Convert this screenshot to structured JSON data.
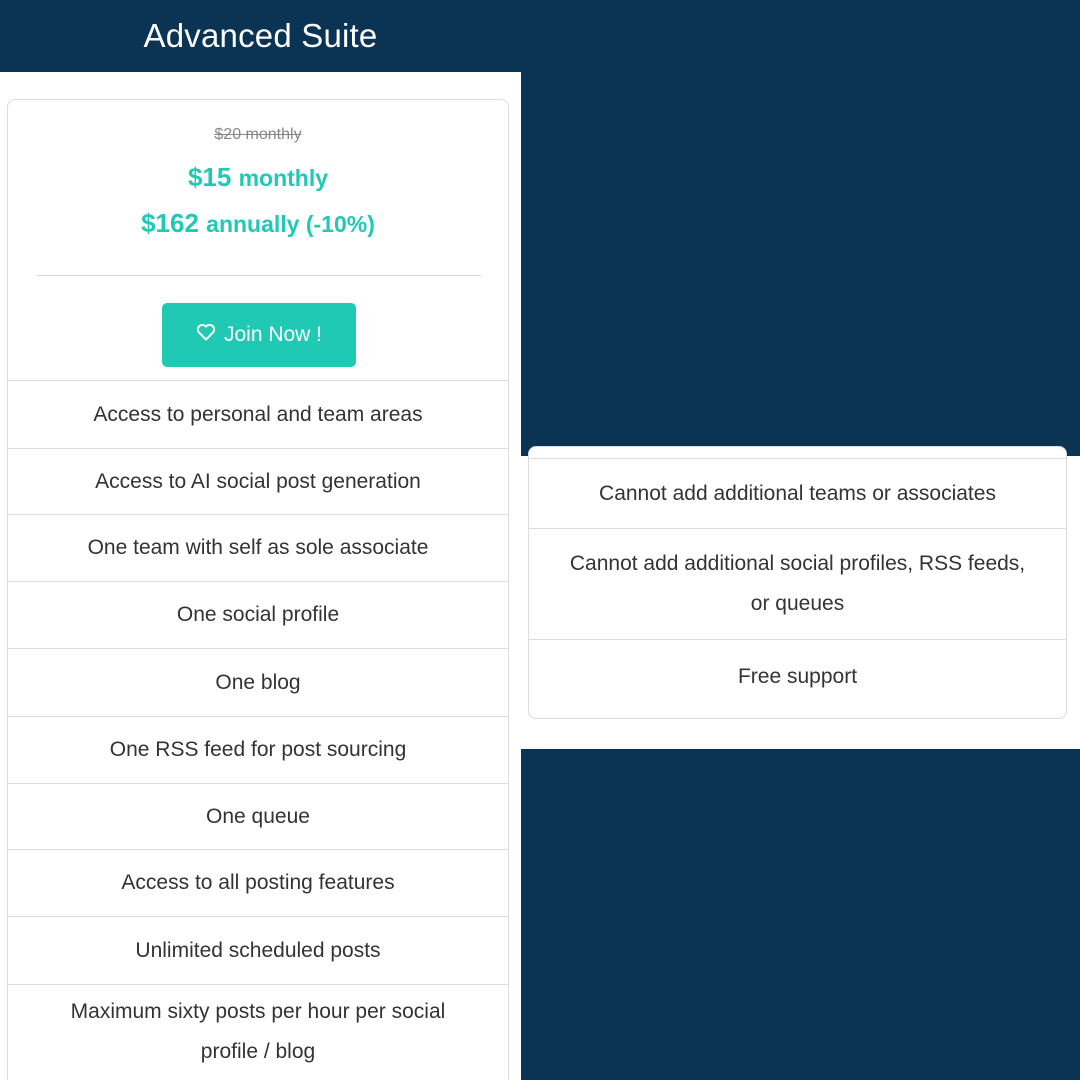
{
  "header": {
    "title": "Advanced Suite"
  },
  "pricing": {
    "old_price": "$20 monthly",
    "monthly_amount": "$15",
    "monthly_unit": "monthly",
    "annual_amount": "$162",
    "annual_unit": "annually (-10%)"
  },
  "cta": {
    "label": "Join Now !",
    "icon": "heart-icon"
  },
  "features": [
    "Access to personal and team areas",
    "Access to AI social post generation",
    "One team with self as sole associate",
    "One social profile",
    "One blog",
    "One RSS feed for post sourcing",
    "One queue",
    "Access to all posting features",
    "Unlimited scheduled posts",
    "Maximum sixty posts per hour per social profile / blog"
  ],
  "features_continued": [
    "Cannot add additional teams or associates",
    "Cannot add additional social profiles, RSS feeds, or queues",
    "Free support"
  ],
  "colors": {
    "background": "#0b3454",
    "accent": "#20c9b4",
    "card_border": "#dcdcdc"
  }
}
